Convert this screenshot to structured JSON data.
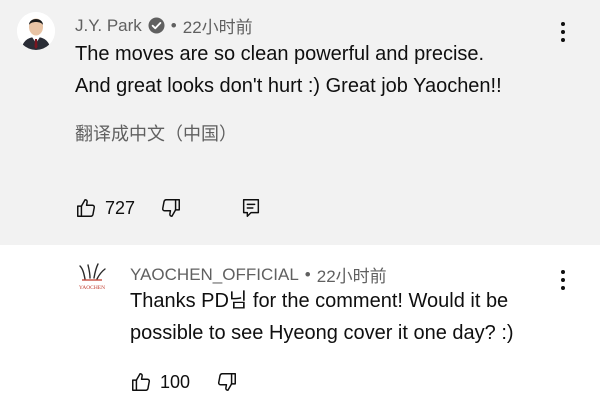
{
  "comment": {
    "author": "J.Y. Park",
    "time": "22小时前",
    "separator": "•",
    "text_line1": "The moves are so clean powerful and precise.",
    "text_line2": "And great looks don't hurt :) Great job Yaochen!!",
    "translate_label": "翻译成中文（中国）",
    "like_count": "727",
    "icons": [
      "avatar",
      "verified-icon",
      "more-vert-icon",
      "thumb-up-icon",
      "thumb-down-icon",
      "reply-icon"
    ]
  },
  "reply": {
    "author": "YAOCHEN_OFFICIAL",
    "time": "22小时前",
    "separator": "•",
    "text_line1": "Thanks PD님 for the comment! Would it be",
    "text_line2": "possible to see Hyeong cover it one day? :)",
    "like_count": "100",
    "avatar_logo_text": "YAOCHEN",
    "icons": [
      "avatar-logo",
      "more-vert-icon",
      "thumb-up-icon",
      "thumb-down-icon"
    ]
  },
  "colors": {
    "main_background": "#f2f2f2",
    "reply_background": "#ffffff",
    "secondary_text": "#606060",
    "primary_text": "#0f0f0f"
  }
}
